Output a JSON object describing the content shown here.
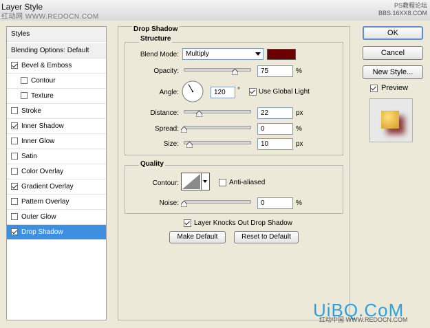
{
  "window": {
    "title": "Layer Style",
    "watermark_left": "红动网 WWW.REDOCN.COM",
    "watermark_right_line1": "PS教程论坛",
    "watermark_right_line2": "BBS.16XX8.COM"
  },
  "styles_panel": {
    "header": "Styles",
    "blending_options": "Blending Options: Default",
    "items": [
      {
        "label": "Bevel & Emboss",
        "checked": true,
        "indent": false
      },
      {
        "label": "Contour",
        "checked": false,
        "indent": true
      },
      {
        "label": "Texture",
        "checked": false,
        "indent": true
      },
      {
        "label": "Stroke",
        "checked": false,
        "indent": false
      },
      {
        "label": "Inner Shadow",
        "checked": true,
        "indent": false
      },
      {
        "label": "Inner Glow",
        "checked": false,
        "indent": false
      },
      {
        "label": "Satin",
        "checked": false,
        "indent": false
      },
      {
        "label": "Color Overlay",
        "checked": false,
        "indent": false
      },
      {
        "label": "Gradient Overlay",
        "checked": true,
        "indent": false
      },
      {
        "label": "Pattern Overlay",
        "checked": false,
        "indent": false
      },
      {
        "label": "Outer Glow",
        "checked": false,
        "indent": false
      },
      {
        "label": "Drop Shadow",
        "checked": true,
        "indent": false,
        "selected": true
      }
    ]
  },
  "drop_shadow": {
    "section_title": "Drop Shadow",
    "structure_title": "Structure",
    "blend_mode_label": "Blend Mode:",
    "blend_mode_value": "Multiply",
    "shadow_color": "#6b0000",
    "opacity_label": "Opacity:",
    "opacity_value": "75",
    "opacity_level": 0.75,
    "opacity_unit": "%",
    "angle_label": "Angle:",
    "angle_value": "120",
    "angle_degrees": 120,
    "angle_unit": "°",
    "use_global_light_label": "Use Global Light",
    "use_global_light": true,
    "distance_label": "Distance:",
    "distance_value": "22",
    "distance_level": 0.22,
    "distance_unit": "px",
    "spread_label": "Spread:",
    "spread_value": "0",
    "spread_level": 0,
    "spread_unit": "%",
    "size_label": "Size:",
    "size_value": "10",
    "size_level": 0.08,
    "size_unit": "px",
    "quality_title": "Quality",
    "contour_label": "Contour:",
    "anti_aliased_label": "Anti-aliased",
    "anti_aliased": false,
    "noise_label": "Noise:",
    "noise_value": "0",
    "noise_level": 0,
    "noise_unit": "%",
    "layer_knocks_out_label": "Layer Knocks Out Drop Shadow",
    "layer_knocks_out": true,
    "make_default_label": "Make Default",
    "reset_default_label": "Reset to Default"
  },
  "side_buttons": {
    "ok_label": "OK",
    "cancel_label": "Cancel",
    "new_style_label": "New Style...",
    "preview_label": "Preview",
    "preview_checked": true
  },
  "brand": {
    "logo": "UiBQ.CoM",
    "sub": "红动中国 WWW.REDOCN.COM"
  }
}
